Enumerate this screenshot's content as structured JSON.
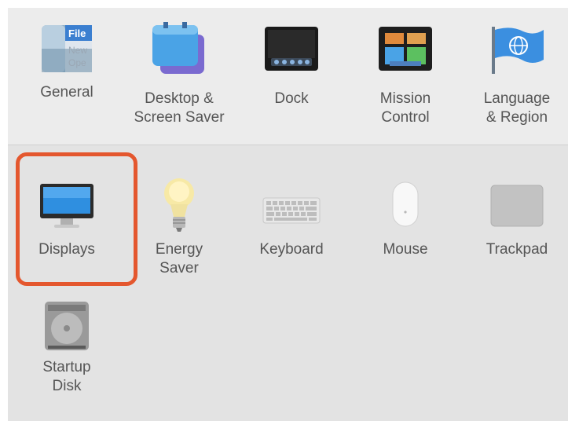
{
  "preferences": {
    "row1": [
      {
        "id": "general",
        "label": "General",
        "icon": "general-icon"
      },
      {
        "id": "desktop",
        "label": "Desktop &\nScreen Saver",
        "icon": "desktop-screen-saver-icon"
      },
      {
        "id": "dock",
        "label": "Dock",
        "icon": "dock-icon"
      },
      {
        "id": "mission",
        "label": "Mission\nControl",
        "icon": "mission-control-icon"
      },
      {
        "id": "language",
        "label": "Language\n& Region",
        "icon": "language-region-icon"
      }
    ],
    "row2": [
      {
        "id": "displays",
        "label": "Displays",
        "icon": "displays-icon"
      },
      {
        "id": "energy",
        "label": "Energy\nSaver",
        "icon": "energy-saver-icon"
      },
      {
        "id": "keyboard",
        "label": "Keyboard",
        "icon": "keyboard-icon"
      },
      {
        "id": "mouse",
        "label": "Mouse",
        "icon": "mouse-icon"
      },
      {
        "id": "trackpad",
        "label": "Trackpad",
        "icon": "trackpad-icon"
      }
    ],
    "row3": [
      {
        "id": "startup",
        "label": "Startup\nDisk",
        "icon": "startup-disk-icon"
      }
    ]
  },
  "general_icon_text": {
    "line1": "File",
    "line2": "New",
    "line3": "Ope"
  },
  "highlight_color": "#e4572e"
}
